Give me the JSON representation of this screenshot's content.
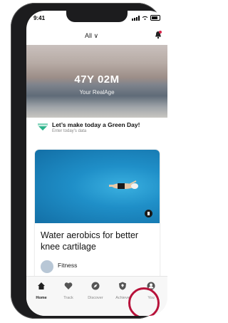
{
  "status_bar": {
    "time": "9:41"
  },
  "header": {
    "filter_label": "All ∨"
  },
  "hero": {
    "age_value": "47Y 02M",
    "age_caption": "Your RealAge"
  },
  "green_day": {
    "title": "Let’s make today a Green Day!",
    "subtitle": "Enter today’s data"
  },
  "article": {
    "title": "Water aerobics for better knee cartilage",
    "category": "Fitness"
  },
  "tabs": [
    {
      "label": "Home",
      "icon": "home-icon"
    },
    {
      "label": "Track",
      "icon": "heart-icon"
    },
    {
      "label": "Discover",
      "icon": "compass-icon"
    },
    {
      "label": "Achieve",
      "icon": "shield-icon"
    },
    {
      "label": "You",
      "icon": "user-icon"
    }
  ],
  "colors": {
    "accent_green": "#2bb38a",
    "highlight_ring": "#b7123a",
    "phone_frame": "#1c1c1e"
  }
}
